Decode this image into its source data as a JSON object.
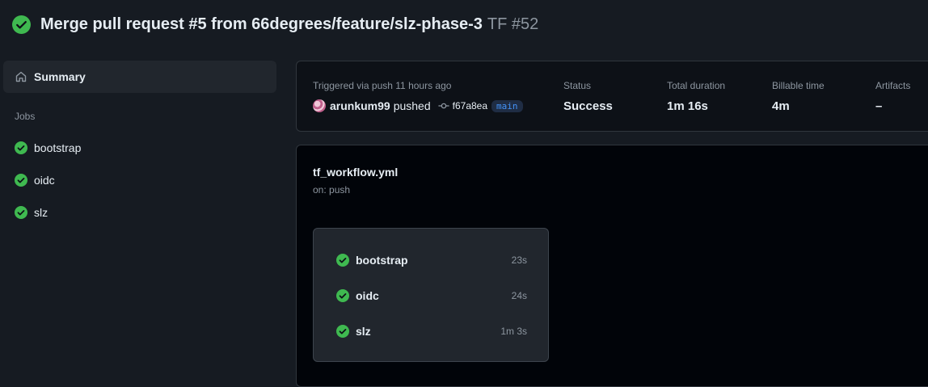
{
  "header": {
    "title": "Merge pull request #5 from 66degrees/feature/slz-phase-3",
    "run_label": "TF #52",
    "status_icon": "check-circle-fill-icon",
    "success_color": "#3fb950"
  },
  "sidebar": {
    "summary_label": "Summary",
    "summary_icon": "home-icon",
    "jobs_heading": "Jobs",
    "jobs": [
      {
        "name": "bootstrap"
      },
      {
        "name": "oidc"
      },
      {
        "name": "slz"
      }
    ]
  },
  "run_info": {
    "triggered_label": "Triggered via push 11 hours ago",
    "actor": "arunkum99",
    "action": "pushed",
    "commit_sha": "f67a8ea",
    "branch": "main",
    "status_label": "Status",
    "status_value": "Success",
    "duration_label": "Total duration",
    "duration_value": "1m 16s",
    "billable_label": "Billable time",
    "billable_value": "4m",
    "artifacts_label": "Artifacts",
    "artifacts_value": "–"
  },
  "workflow": {
    "file": "tf_workflow.yml",
    "trigger": "on: push",
    "jobs": [
      {
        "name": "bootstrap",
        "duration": "23s"
      },
      {
        "name": "oidc",
        "duration": "24s"
      },
      {
        "name": "slz",
        "duration": "1m 3s"
      }
    ]
  }
}
